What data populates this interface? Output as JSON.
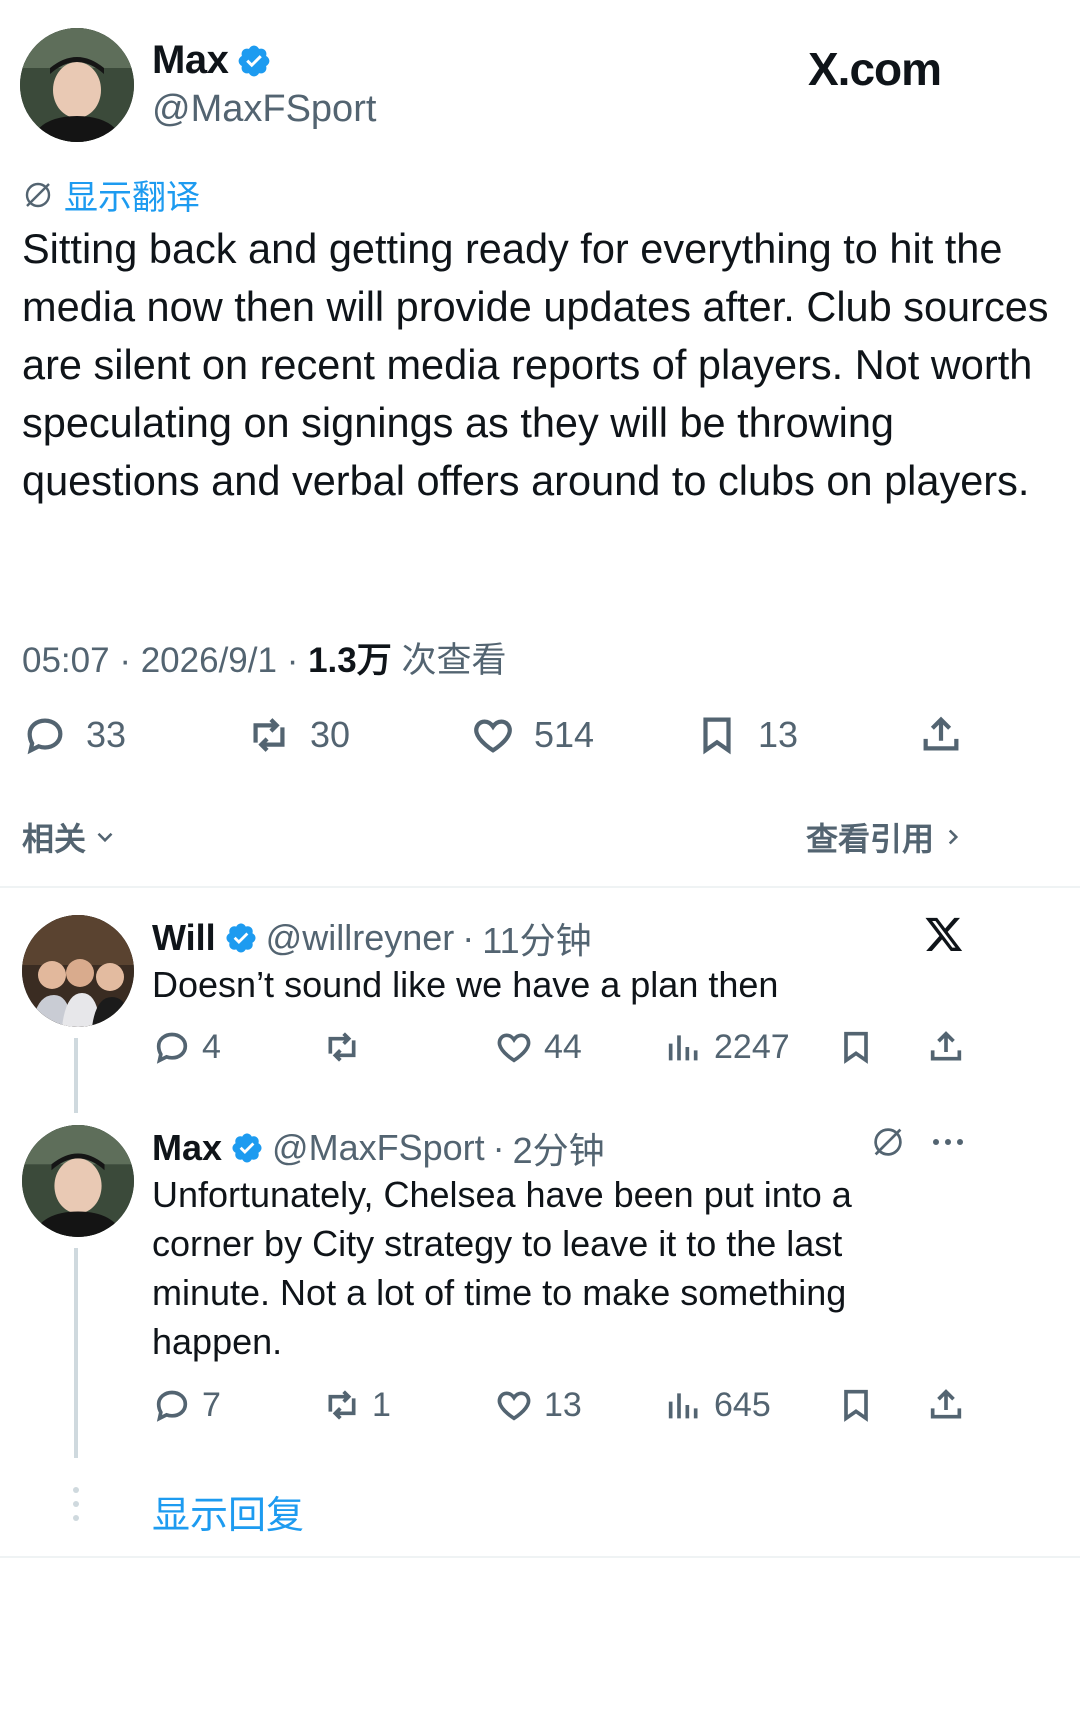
{
  "header": {
    "author_name": "Max",
    "author_handle": "@MaxFSport",
    "brand": "X.com"
  },
  "tweet": {
    "translate_label": "显示翻译",
    "text": "Sitting back and getting ready for everything to hit the media now then will provide updates after. Club sources are silent on recent media reports of players. Not worth speculating on signings as they will be throwing questions and verbal offers around to clubs on players.",
    "time": "05:07",
    "date": "2026/9/1",
    "views": "1.3万",
    "views_label": "次查看",
    "replies": "33",
    "reposts": "30",
    "likes": "514",
    "bookmarks": "13"
  },
  "related": {
    "label": "相关",
    "quotes_label": "查看引用"
  },
  "replies": [
    {
      "name": "Will",
      "handle": "@willreyner",
      "time": "11分钟",
      "text": "Doesn’t sound like we have a plan then",
      "replies": "4",
      "reposts": "",
      "likes": "44",
      "views": "2247"
    },
    {
      "name": "Max",
      "handle": "@MaxFSport",
      "time": "2分钟",
      "text": "Unfortunately, Chelsea have been put into a corner by City strategy to leave it to the last minute. Not a lot of time to make something happen.",
      "replies": "7",
      "reposts": "1",
      "likes": "13",
      "views": "645"
    }
  ],
  "show_replies_label": "显示回复",
  "colors": {
    "accent": "#1d9bf0",
    "text": "#0f1419",
    "secondary": "#536471"
  }
}
